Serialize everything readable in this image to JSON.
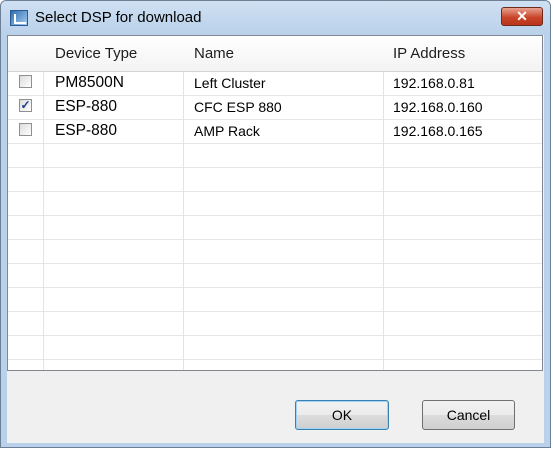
{
  "window": {
    "title": "Select DSP for download",
    "close_glyph": "✕",
    "icon": "dsp-app-icon"
  },
  "table": {
    "columns": [
      "Device Type",
      "Name",
      "IP Address"
    ],
    "rows": [
      {
        "checked": false,
        "device_type": "PM8500N",
        "name": "Left Cluster",
        "ip": "192.168.0.81"
      },
      {
        "checked": true,
        "device_type": "ESP-880",
        "name": "CFC ESP 880",
        "ip": "192.168.0.160"
      },
      {
        "checked": false,
        "device_type": "ESP-880",
        "name": "AMP Rack",
        "ip": "192.168.0.165"
      }
    ]
  },
  "buttons": {
    "ok_label": "OK",
    "cancel_label": "Cancel"
  },
  "colors": {
    "title_bar": "#b9d1ea",
    "close_button": "#c9452a",
    "ok_focus_border": "#3c7fb1"
  }
}
